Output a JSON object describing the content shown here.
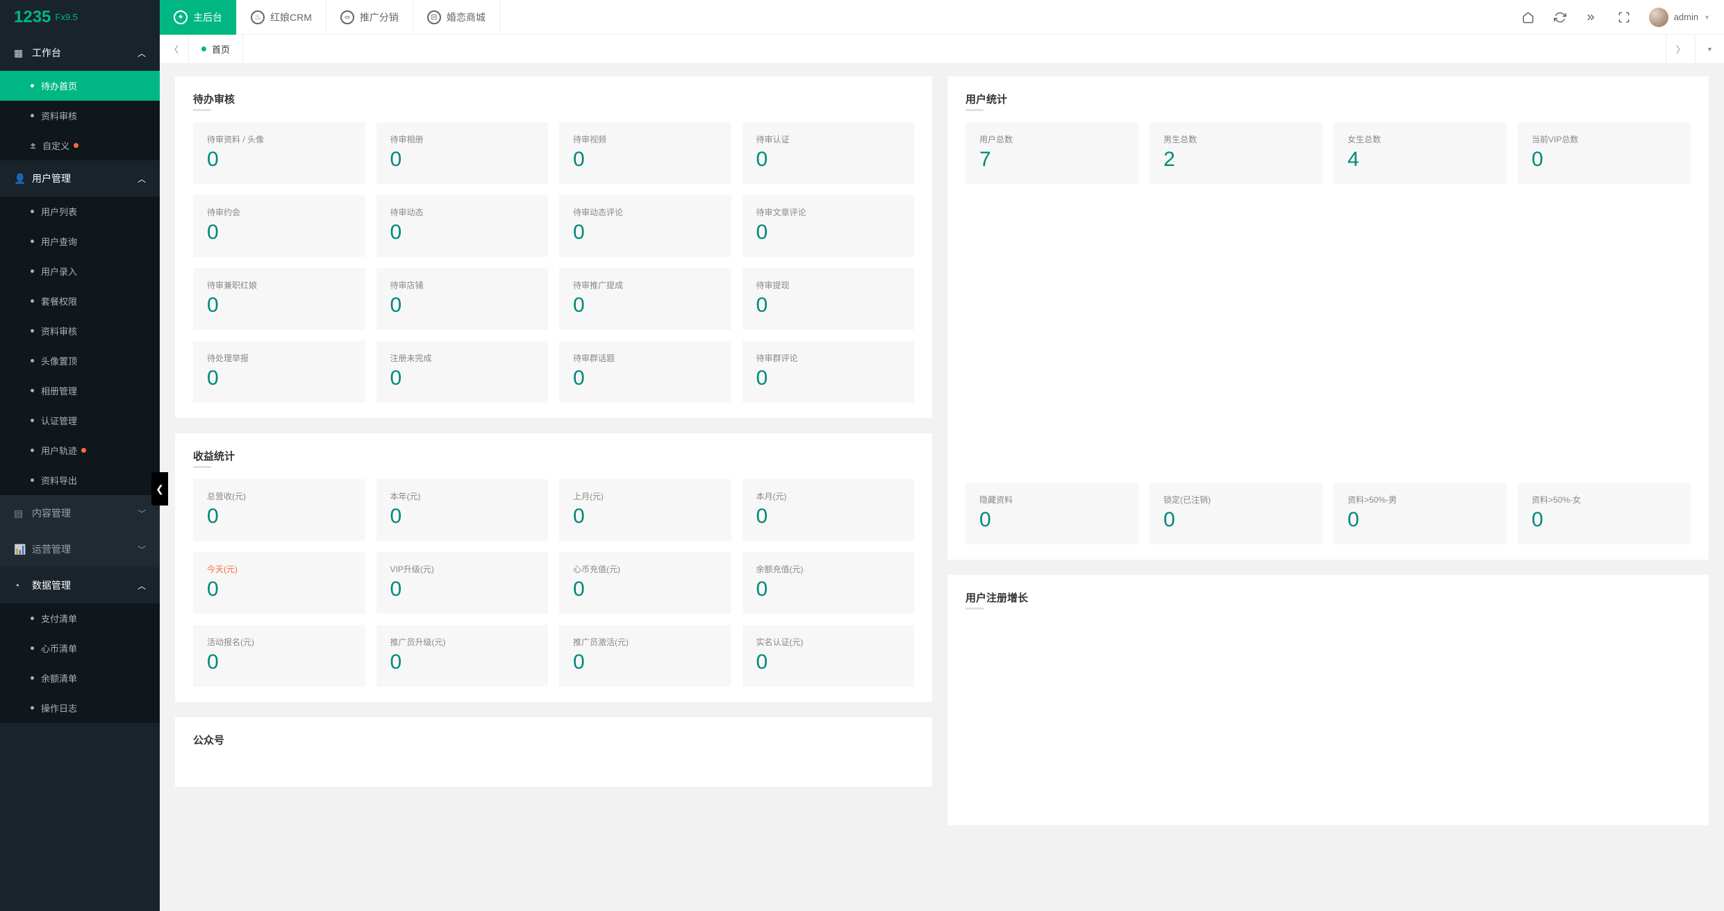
{
  "brand": {
    "number": "1235",
    "version": "Fx9.5"
  },
  "topnav": [
    {
      "label": "主后台",
      "active": true
    },
    {
      "label": "红娘CRM",
      "active": false
    },
    {
      "label": "推广分销",
      "active": false
    },
    {
      "label": "婚恋商城",
      "active": false
    }
  ],
  "user": {
    "name": "admin"
  },
  "tabstrip": {
    "home": "首页"
  },
  "sidebar": {
    "g1": {
      "label": "工作台"
    },
    "g1_items": [
      {
        "label": "待办首页",
        "active": true
      },
      {
        "label": "资料审核"
      },
      {
        "label": "自定义",
        "plus": true,
        "badge": true
      }
    ],
    "g2": {
      "label": "用户管理"
    },
    "g2_items": [
      {
        "label": "用户列表"
      },
      {
        "label": "用户查询"
      },
      {
        "label": "用户录入"
      },
      {
        "label": "套餐权限"
      },
      {
        "label": "资料审核"
      },
      {
        "label": "头像置顶"
      },
      {
        "label": "相册管理"
      },
      {
        "label": "认证管理"
      },
      {
        "label": "用户轨迹",
        "badge": true
      },
      {
        "label": "资料导出"
      }
    ],
    "g3": {
      "label": "内容管理"
    },
    "g4": {
      "label": "运营管理"
    },
    "g5": {
      "label": "数据管理"
    },
    "g5_items": [
      {
        "label": "支付清单"
      },
      {
        "label": "心币清单"
      },
      {
        "label": "余额清单"
      },
      {
        "label": "操作日志"
      }
    ]
  },
  "panels": {
    "pending": {
      "title": "待办审核",
      "items": [
        {
          "label": "待审资料 / 头像",
          "value": "0"
        },
        {
          "label": "待审相册",
          "value": "0"
        },
        {
          "label": "待审视频",
          "value": "0"
        },
        {
          "label": "待审认证",
          "value": "0"
        },
        {
          "label": "待审约会",
          "value": "0"
        },
        {
          "label": "待审动态",
          "value": "0"
        },
        {
          "label": "待审动态评论",
          "value": "0"
        },
        {
          "label": "待审文章评论",
          "value": "0"
        },
        {
          "label": "待审兼职红娘",
          "value": "0"
        },
        {
          "label": "待审店铺",
          "value": "0"
        },
        {
          "label": "待审推广提成",
          "value": "0"
        },
        {
          "label": "待审提现",
          "value": "0"
        },
        {
          "label": "待处理举报",
          "value": "0"
        },
        {
          "label": "注册未完成",
          "value": "0"
        },
        {
          "label": "待审群话题",
          "value": "0"
        },
        {
          "label": "待审群评论",
          "value": "0"
        }
      ]
    },
    "revenue": {
      "title": "收益统计",
      "items": [
        {
          "label": "总营收(元)",
          "value": "0"
        },
        {
          "label": "本年(元)",
          "value": "0"
        },
        {
          "label": "上月(元)",
          "value": "0"
        },
        {
          "label": "本月(元)",
          "value": "0"
        },
        {
          "label": "今天(元)",
          "value": "0",
          "hot": true
        },
        {
          "label": "VIP升级(元)",
          "value": "0"
        },
        {
          "label": "心币充值(元)",
          "value": "0"
        },
        {
          "label": "余额充值(元)",
          "value": "0"
        },
        {
          "label": "活动报名(元)",
          "value": "0"
        },
        {
          "label": "推广员升级(元)",
          "value": "0"
        },
        {
          "label": "推广员激活(元)",
          "value": "0"
        },
        {
          "label": "实名认证(元)",
          "value": "0"
        }
      ]
    },
    "wechat": {
      "title": "公众号"
    },
    "users": {
      "title": "用户统计",
      "top": [
        {
          "label": "用户总数",
          "value": "7"
        },
        {
          "label": "男生总数",
          "value": "2"
        },
        {
          "label": "女生总数",
          "value": "4"
        },
        {
          "label": "当前VIP总数",
          "value": "0"
        }
      ],
      "bottom": [
        {
          "label": "隐藏资料",
          "value": "0"
        },
        {
          "label": "锁定(已注销)",
          "value": "0"
        },
        {
          "label": "资料>50%-男",
          "value": "0"
        },
        {
          "label": "资料>50%-女",
          "value": "0"
        }
      ]
    },
    "growth": {
      "title": "用户注册增长"
    }
  }
}
